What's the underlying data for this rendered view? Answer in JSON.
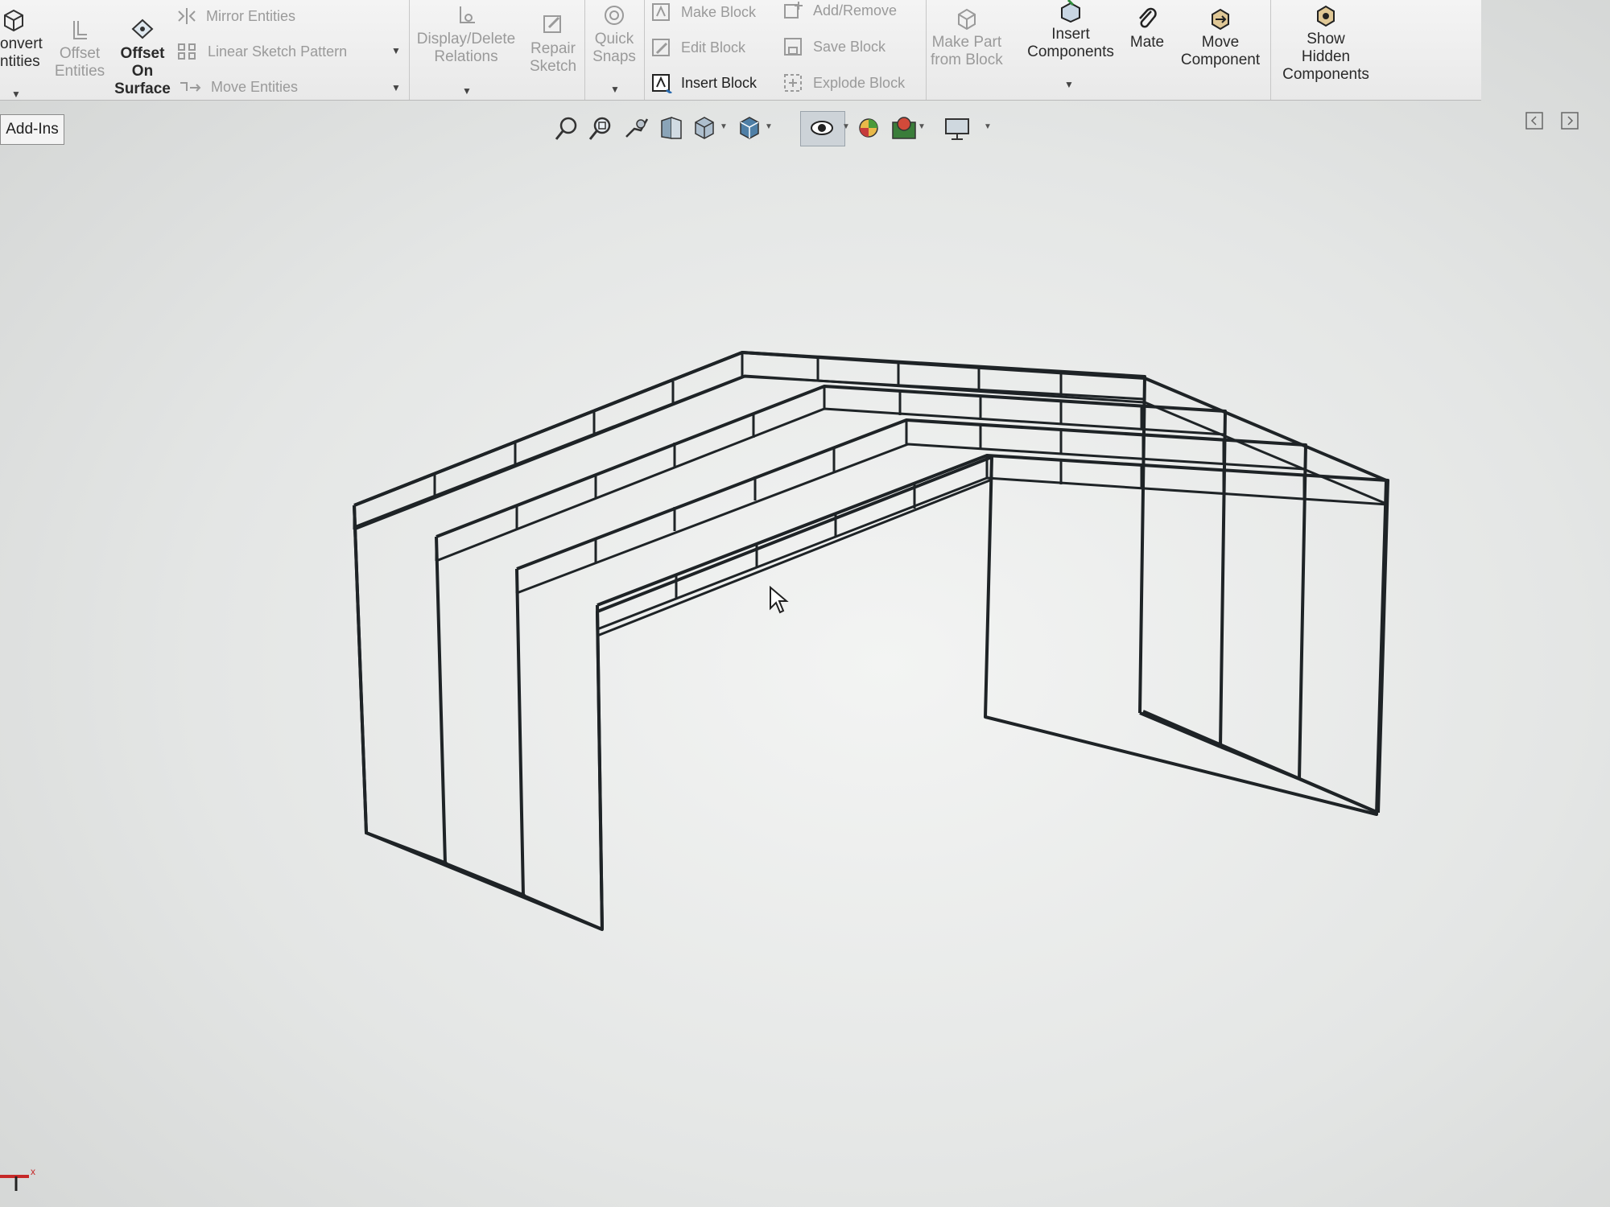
{
  "ribbon": {
    "convert_entities": "onvert\nntities",
    "offset_entities": "Offset\nEntities",
    "offset_on_surface": "Offset\nOn\nSurface",
    "mirror_entities": "Mirror Entities",
    "linear_sketch_pattern": "Linear Sketch Pattern",
    "move_entities": "Move Entities",
    "display_delete_relations": "Display/Delete\nRelations",
    "repair_sketch": "Repair\nSketch",
    "quick_snaps": "Quick\nSnaps",
    "make_block": "Make Block",
    "edit_block": "Edit Block",
    "insert_block": "Insert Block",
    "add_remove": "Add/Remove",
    "save_block": "Save Block",
    "explode_block": "Explode Block",
    "make_part_from_block": "Make Part\nfrom Block",
    "insert_components": "Insert\nComponents",
    "mate": "Mate",
    "move_component": "Move\nComponent",
    "show_hidden_components": "Show\nHidden\nComponents"
  },
  "tabs": {
    "add_ins": "Add-Ins"
  },
  "icons": {
    "view_toolbar": [
      "zoom-to-fit-icon",
      "zoom-to-area-icon",
      "previous-view-icon",
      "section-view-icon",
      "view-orientation-icon",
      "display-style-icon",
      "hide-show-items-icon",
      "edit-appearance-icon",
      "apply-scene-icon",
      "view-settings-icon"
    ]
  },
  "colors": {
    "ribbon": "#eeeeee",
    "viewport": "#e4e6e5",
    "wireframe": "#1e2326"
  }
}
